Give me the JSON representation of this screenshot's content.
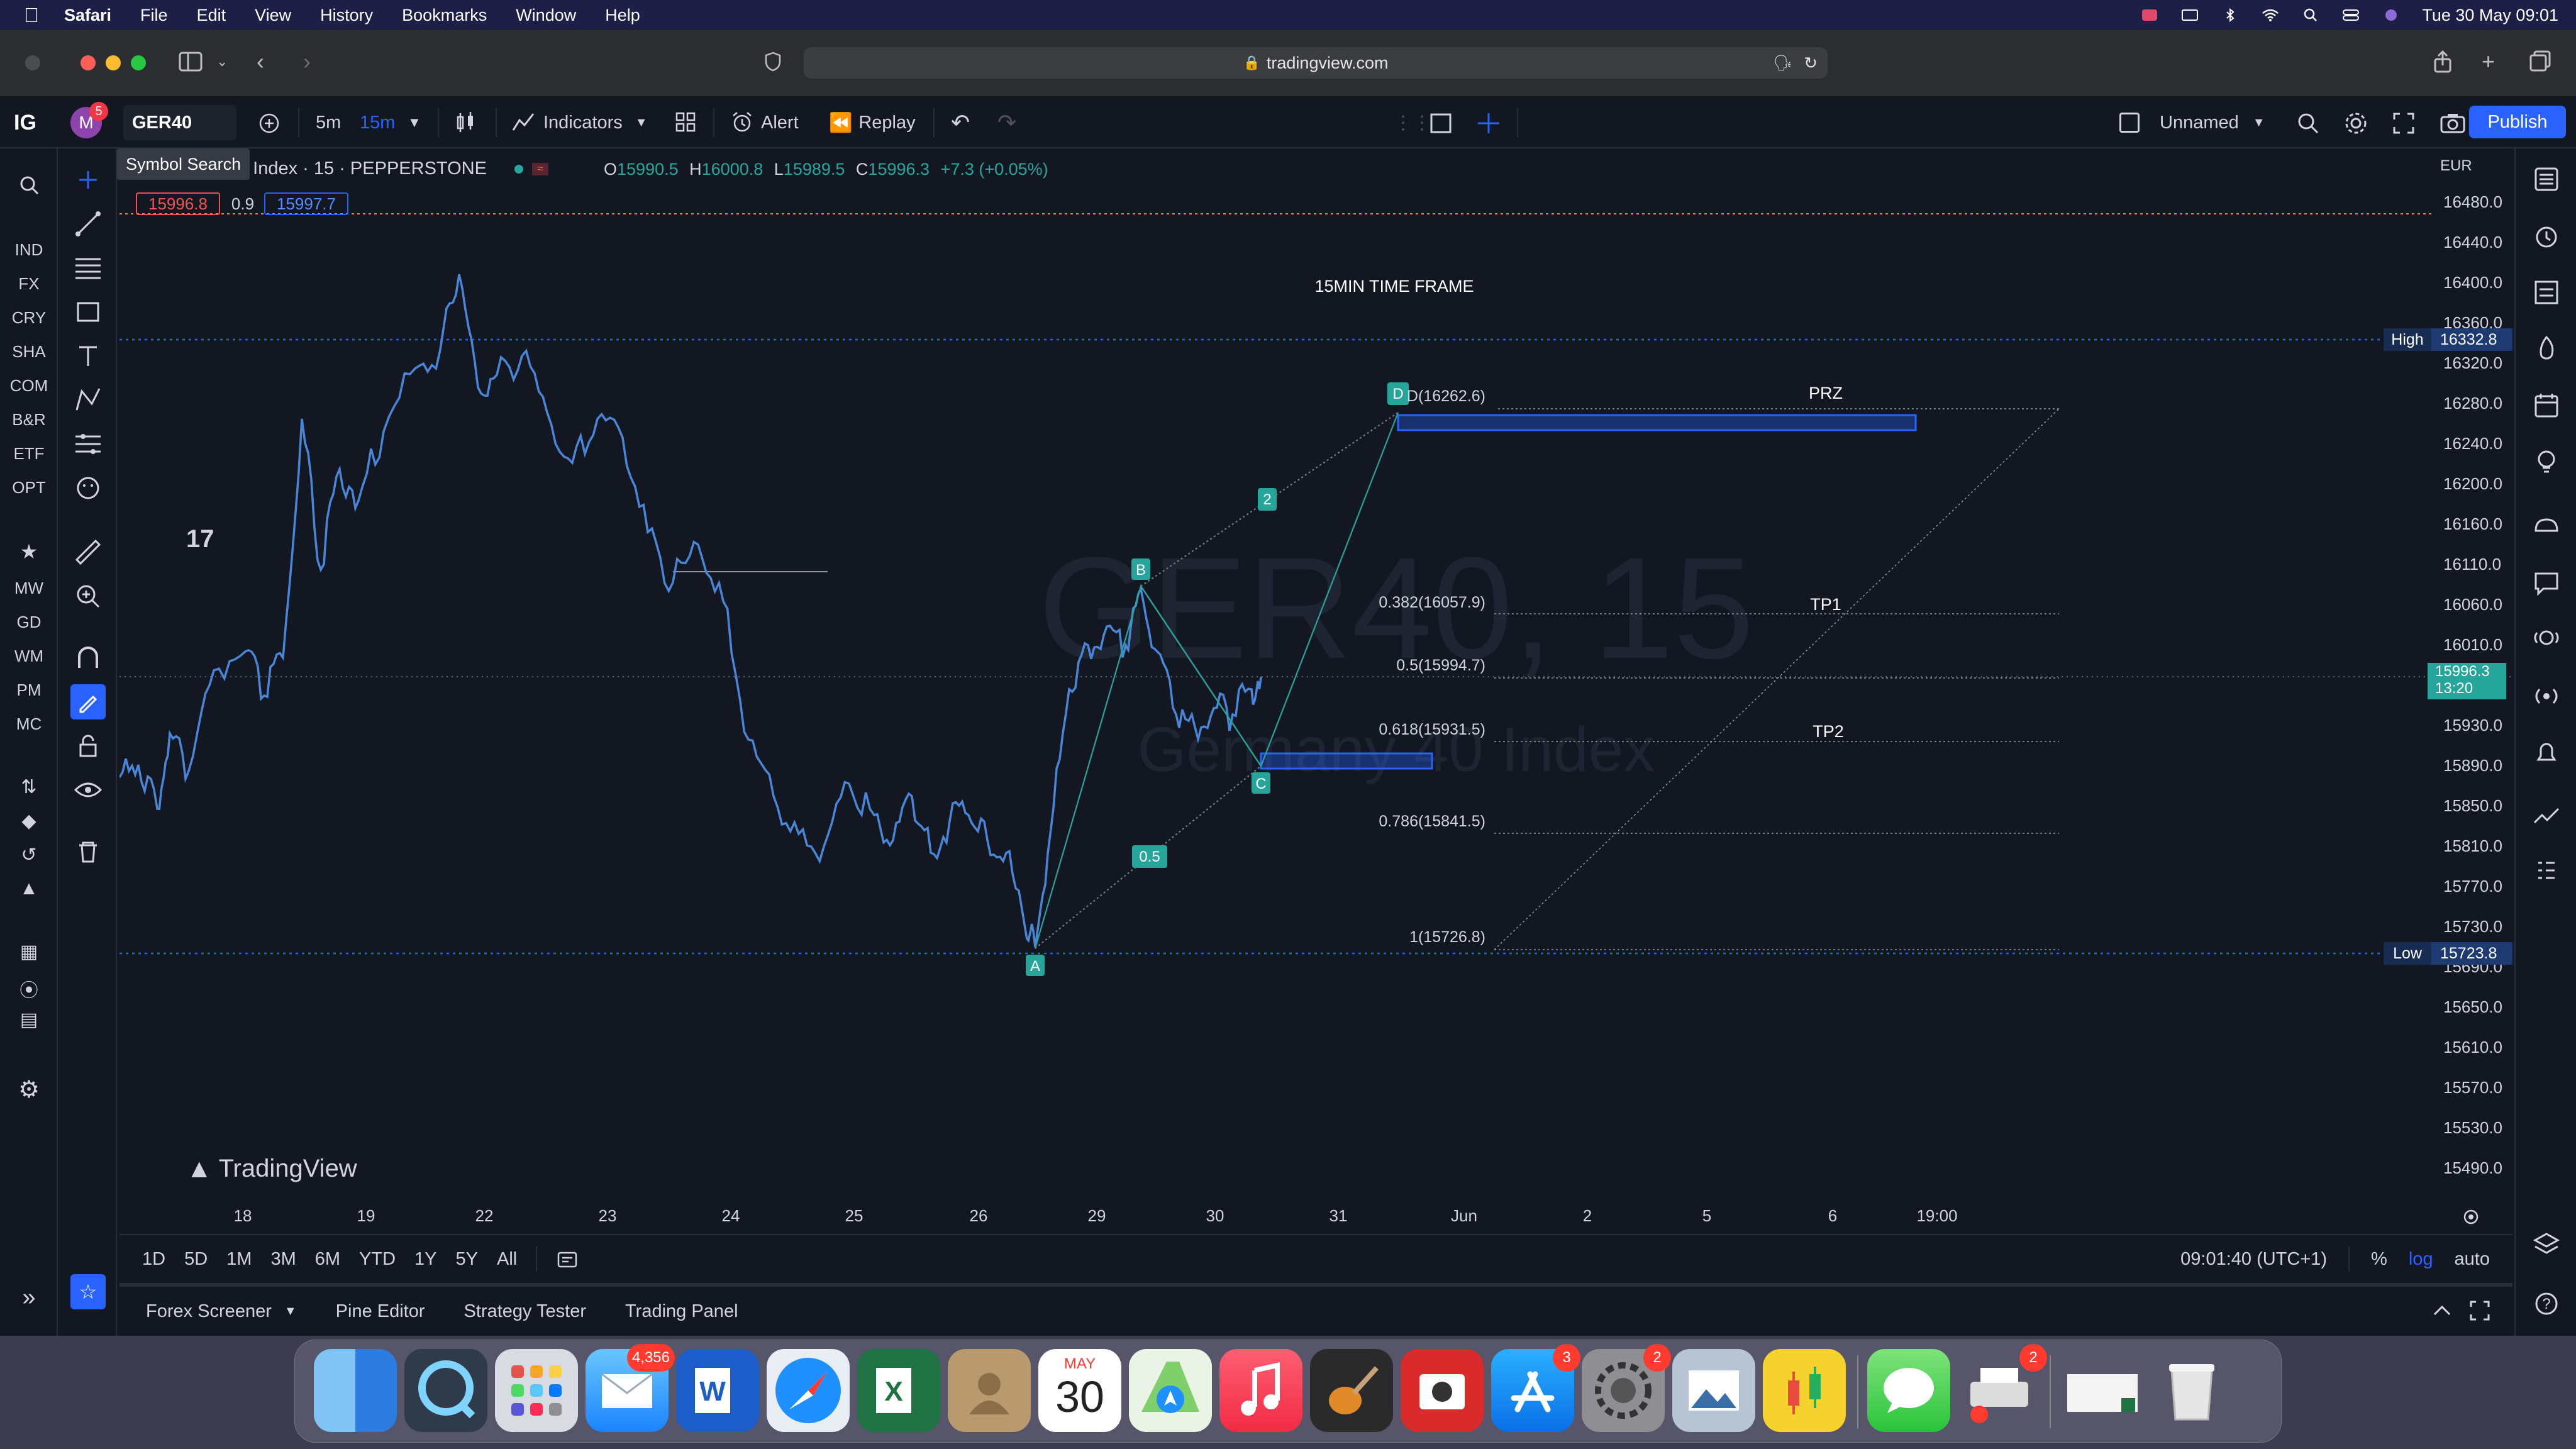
{
  "menubar": {
    "app": "Safari",
    "items": [
      "File",
      "Edit",
      "View",
      "History",
      "Bookmarks",
      "Window",
      "Help"
    ],
    "datetime": "Tue 30 May  09:01"
  },
  "browser": {
    "url": "tradingview.com"
  },
  "toolbar": {
    "badge_count": "5",
    "avatar_letter": "M",
    "symbol": "GER40",
    "intervals": [
      "5m",
      "15m"
    ],
    "indicators_label": "Indicators",
    "alert_label": "Alert",
    "replay_label": "Replay",
    "layout_name": "Unnamed",
    "publish_label": "Publish",
    "tooltip": "Symbol Search",
    "logo": "IG"
  },
  "markets": [
    "IND",
    "FX",
    "CRY",
    "SHA",
    "COM",
    "B&R",
    "ETF",
    "OPT"
  ],
  "markets2": [
    "MW",
    "GD",
    "WM",
    "PM",
    "MC"
  ],
  "legend": {
    "title": "0 Index · 15 · PEPPERSTONE",
    "o_label": "O",
    "o": "15990.5",
    "h_label": "H",
    "h": "16000.8",
    "l_label": "L",
    "l": "15989.5",
    "c_label": "C",
    "c": "15996.3",
    "change": "+7.3 (+0.05%)",
    "bid": "15996.8",
    "spread": "0.9",
    "ask": "15997.7"
  },
  "annotations": {
    "timeframe": "15MIN TIME FRAME",
    "prz": "PRZ",
    "tp1": "TP1",
    "tp2": "TP2",
    "d_label": "D",
    "d_price": "D(16262.6)",
    "fib": [
      "0.382(16057.9)",
      "0.5(15994.7)",
      "0.618(15931.5)",
      "0.786(15841.5)",
      "1(15726.8)"
    ],
    "points": [
      "A",
      "B",
      "C"
    ],
    "ratios": [
      "2",
      "0.5"
    ],
    "watermark_symbol": "GER40, 15",
    "watermark_desc": "Germany 40 Index",
    "brand": "TradingView"
  },
  "price_axis": {
    "currency": "EUR",
    "ticks": [
      "16480.0",
      "16440.0",
      "16400.0",
      "16360.0",
      "16320.0",
      "16280.0",
      "16240.0",
      "16200.0",
      "16160.0",
      "16110.0",
      "16060.0",
      "16010.0",
      "15970.0",
      "15930.0",
      "15890.0",
      "15850.0",
      "15810.0",
      "15770.0",
      "15730.0",
      "15690.0",
      "15650.0",
      "15610.0",
      "15570.0",
      "15530.0",
      "15490.0"
    ],
    "high_label": "High",
    "high": "16332.8",
    "low_label": "Low",
    "low": "15723.8",
    "last": "15996.3",
    "countdown": "13:20"
  },
  "time_axis": [
    "18",
    "19",
    "22",
    "23",
    "24",
    "25",
    "26",
    "29",
    "30",
    "31",
    "Jun",
    "2",
    "5",
    "6",
    "19:00"
  ],
  "range_bar": {
    "ranges": [
      "1D",
      "5D",
      "1M",
      "3M",
      "6M",
      "YTD",
      "1Y",
      "5Y",
      "All"
    ],
    "clock": "09:01:40 (UTC+1)",
    "pct": "%",
    "log": "log",
    "auto": "auto"
  },
  "bottom_panels": [
    "Forex Screener",
    "Pine Editor",
    "Strategy Tester",
    "Trading Panel"
  ],
  "dock": {
    "mail_badge": "4,356",
    "calendar_month": "MAY",
    "calendar_day": "30",
    "appstore_badge": "3",
    "settings_badge": "2",
    "printer_badge": "2"
  },
  "colors": {
    "bg": "#131722",
    "accent": "#2962ff",
    "bull": "#26a69a",
    "bear": "#ef5350",
    "wave": "#26a69a",
    "fib": "#d1d4dc"
  }
}
